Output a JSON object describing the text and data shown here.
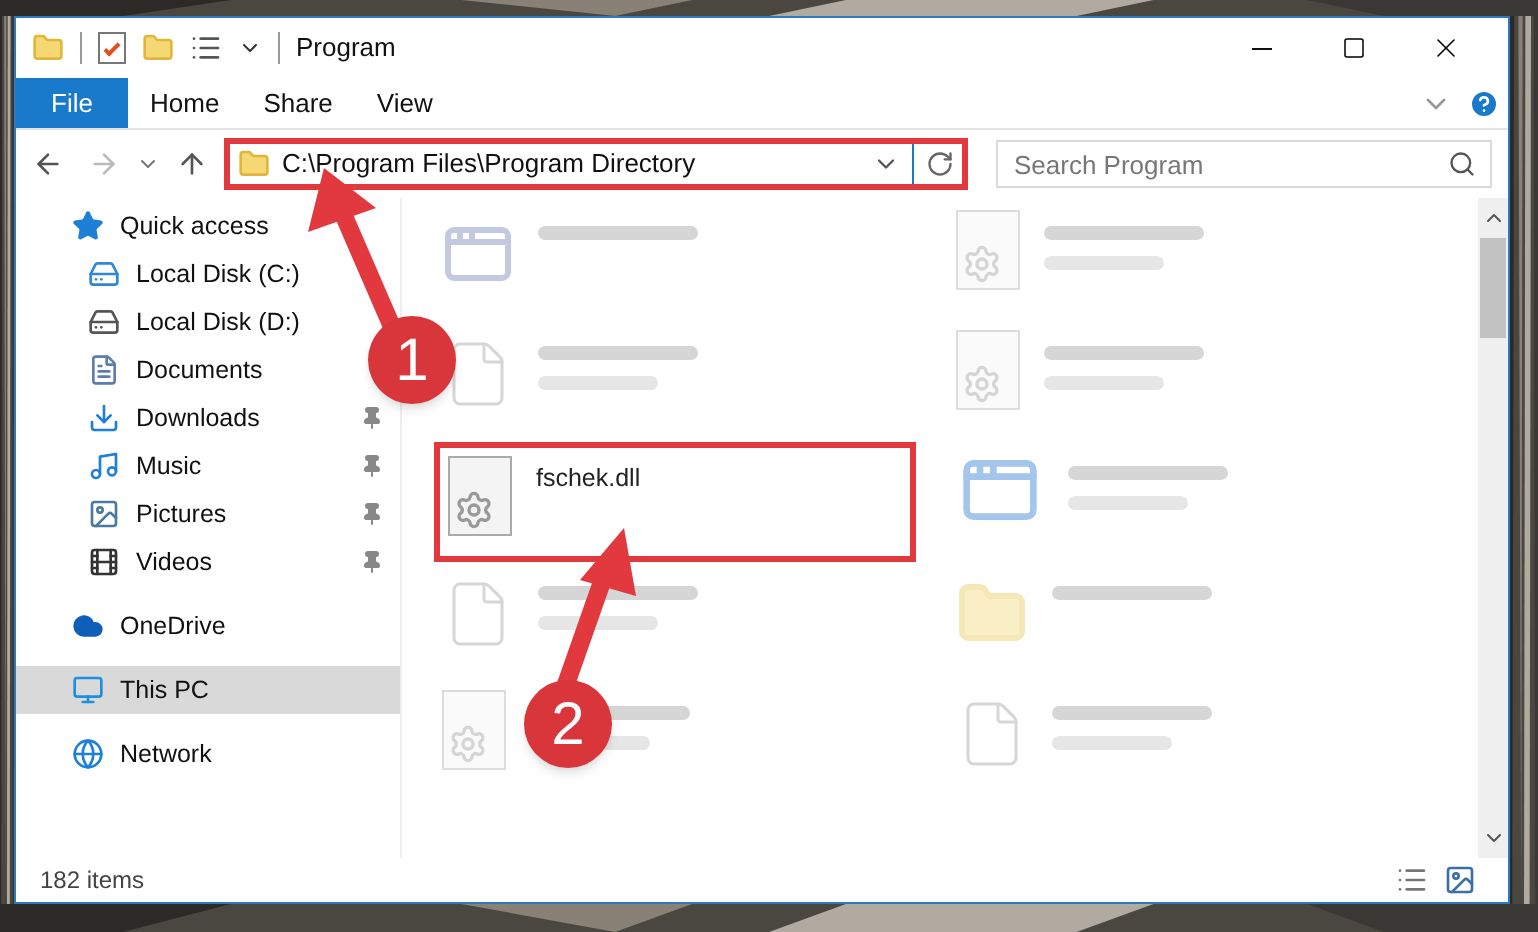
{
  "window": {
    "title": "Program"
  },
  "ribbon_tabs": [
    {
      "label": "File",
      "kind": "file"
    },
    {
      "label": "Home",
      "kind": "tab"
    },
    {
      "label": "Share",
      "kind": "tab"
    },
    {
      "label": "View",
      "kind": "tab"
    }
  ],
  "address": {
    "path": "C:\\Program Files\\Program Directory",
    "highlighted": true
  },
  "search": {
    "placeholder": "Search Program"
  },
  "nav": [
    {
      "label": "Quick access",
      "kind": "star",
      "selected": false,
      "children": [
        {
          "label": "Local Disk (C:)",
          "kind": "disk-c"
        },
        {
          "label": "Local Disk (D:)",
          "kind": "disk"
        },
        {
          "label": "Documents",
          "kind": "documents"
        },
        {
          "label": "Downloads",
          "kind": "downloads",
          "pinned": true
        },
        {
          "label": "Music",
          "kind": "music",
          "pinned": true
        },
        {
          "label": "Pictures",
          "kind": "pictures",
          "pinned": true
        },
        {
          "label": "Videos",
          "kind": "videos",
          "pinned": true
        }
      ]
    },
    {
      "label": "OneDrive",
      "kind": "cloud",
      "selected": false
    },
    {
      "label": "This PC",
      "kind": "pc",
      "selected": true
    },
    {
      "label": "Network",
      "kind": "network",
      "selected": false
    }
  ],
  "files": [
    {
      "kind": "exe",
      "blurred": true,
      "has_type": false
    },
    {
      "kind": "dll",
      "blurred": true,
      "has_type": true
    },
    {
      "kind": "doc",
      "blurred": true,
      "has_type": true
    },
    {
      "kind": "dll",
      "blurred": true,
      "has_type": true
    },
    {
      "name": "fschek.dll",
      "kind": "dll",
      "blurred": false,
      "highlighted": true
    },
    {
      "kind": "app",
      "blurred": true,
      "has_type": true
    },
    {
      "kind": "doc",
      "blurred": true,
      "has_type": true
    },
    {
      "kind": "folder",
      "blurred": true,
      "has_type": false
    },
    {
      "kind": "dll",
      "blurred": true,
      "has_type": true
    },
    {
      "kind": "doc",
      "blurred": true,
      "has_type": true
    }
  ],
  "status_bar": {
    "count": "182 items"
  },
  "annotations": [
    {
      "number": "1"
    },
    {
      "number": "2"
    }
  ]
}
